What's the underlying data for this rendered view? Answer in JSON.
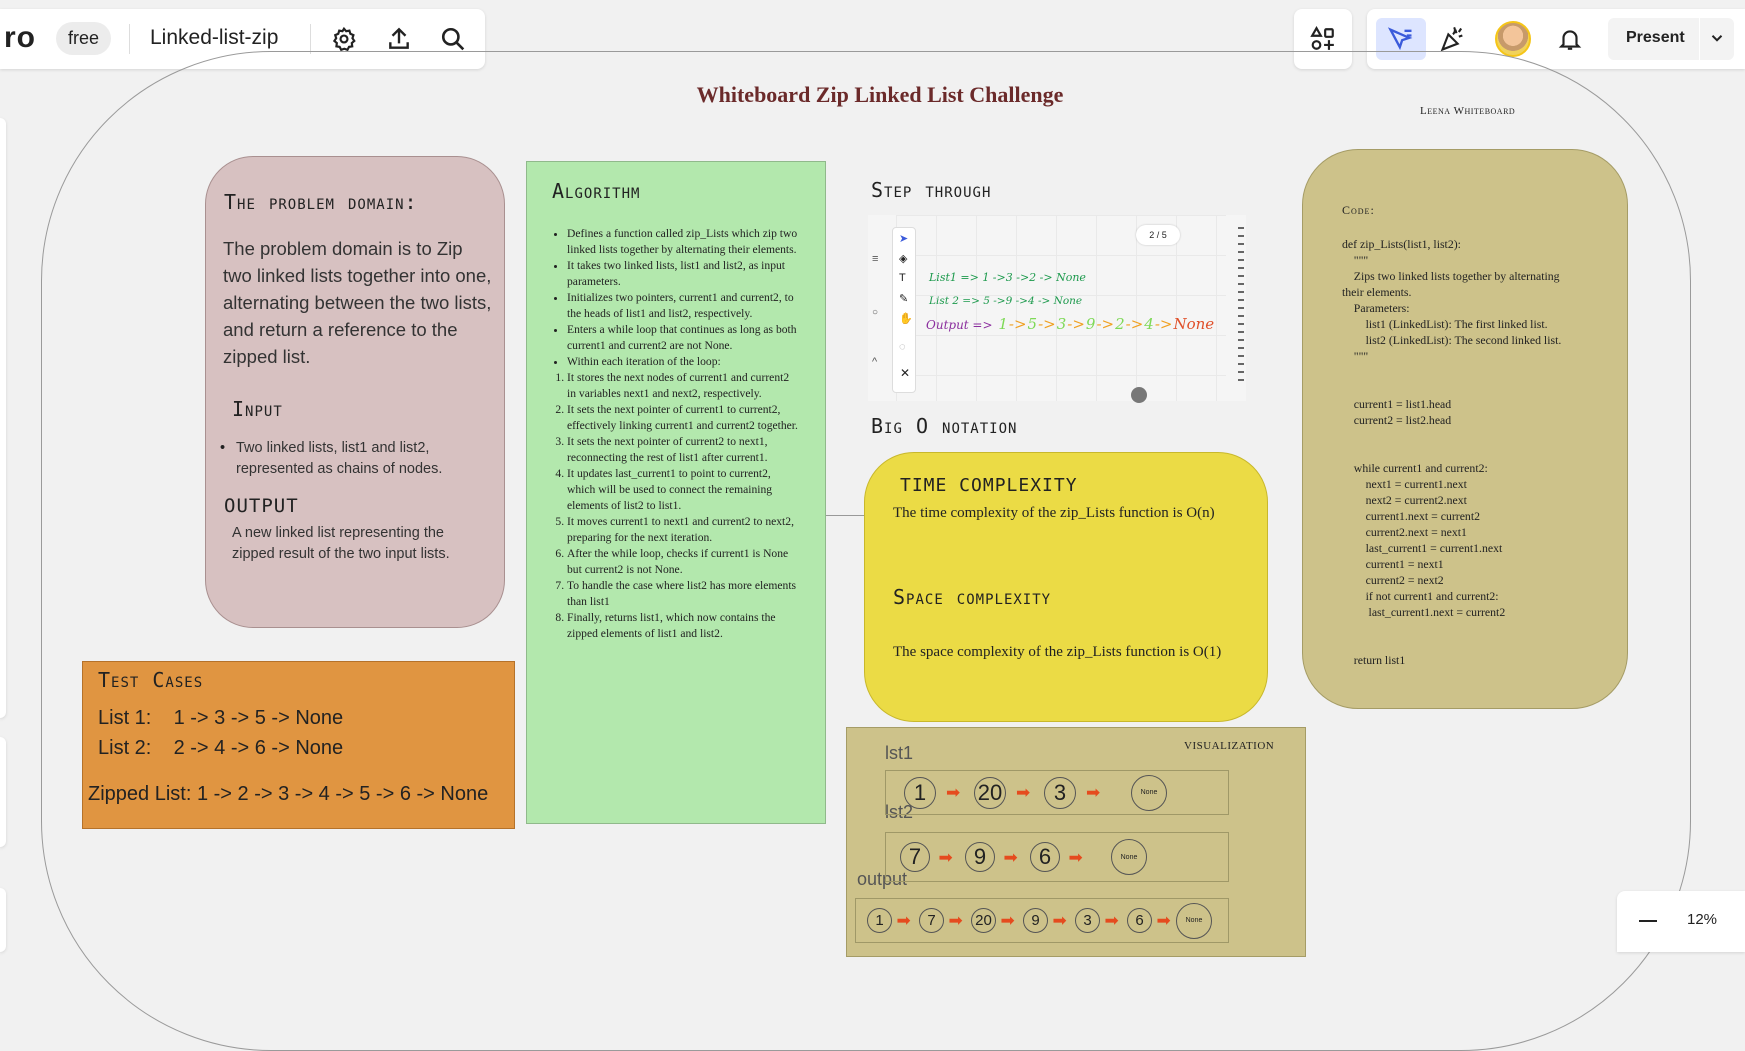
{
  "toolbar": {
    "logo": "ro",
    "plan_badge": "free",
    "board_name": "Linked-list-zip",
    "present_label": "Present",
    "zoom_level": "12%"
  },
  "icons": {
    "settings": "gear-icon",
    "export": "upload-icon",
    "search": "search-icon",
    "apps": "apps-icon",
    "cursor": "select-cursor-icon",
    "celebrate": "party-popper-icon",
    "bell": "bell-icon",
    "chevron": "chevron-down-icon",
    "zoom_out": "minus-icon"
  },
  "colors": {
    "accent_selected": "#dde5ff",
    "title_color": "#6b2a2a",
    "pink_card": "#d7c1c1",
    "green_card": "#b3e8ad",
    "orange_card": "#e09541",
    "yellow_card": "#ebdb45",
    "olive_card": "#cdc28a",
    "arrow": "#e54b1e"
  },
  "board": {
    "title": "Whiteboard Zip Linked List Challenge",
    "author": "Leena Whiteboard",
    "problem": {
      "heading": "The problem domain:",
      "text": "The problem domain is to Zip two linked lists together into one, alternating between the two lists, and return a reference to the zipped list.",
      "input_heading": "Input",
      "input_item": "Two linked lists, list1 and list2, represented as chains of nodes.",
      "output_heading": "OUTPUT",
      "output_text": "A new linked list representing the zipped result of the two input lists."
    },
    "test_cases": {
      "heading": "Test Cases",
      "list1": "List 1:    1 -> 3 -> 5 -> None",
      "list2": "List 2:    2 -> 4 -> 6 -> None",
      "zipped": "Zipped List: 1 -> 2 -> 3 -> 4 -> 5 -> 6 -> None"
    },
    "algorithm": {
      "heading": "Algorithm",
      "bullets": [
        "Defines a function called zip_Lists which zip two linked lists together by alternating their elements.",
        " It takes two linked lists, list1 and list2, as input parameters.",
        " Initializes two pointers, current1 and current2, to the heads of list1 and list2, respectively.",
        " Enters a while loop that continues as long as both current1 and current2 are not None.",
        " Within each iteration of the loop:"
      ],
      "steps": [
        "It stores the next nodes of current1 and current2 in variables next1 and next2, respectively.",
        "It sets the next pointer of current1 to current2, effectively linking current1 and current2 together.",
        "It sets the next pointer of current2 to next1, reconnecting the rest of list1 after current1.",
        "It updates last_current1 to point to current2, which will be used to connect the remaining elements of list2 to list1.",
        "It moves current1 to next1 and current2 to next2, preparing for the next iteration.",
        "After the while loop, checks if current1 is None but current2 is not None.",
        " To handle the case where list2 has more elements than list1",
        " Finally,  returns list1, which now contains the zipped elements of list1 and list2."
      ]
    },
    "step_through": {
      "heading": "Step through",
      "page_counter": "2 / 5",
      "line1": "List1 => 1 ->3 ->2 -> None",
      "line2": "List 2 => 5 ->9 ->4 -> None",
      "line3_label": "Output =>",
      "line3_values": [
        "1",
        "->",
        "5",
        "->",
        "3",
        "->",
        "9",
        "->",
        "2",
        "->",
        "4",
        "->",
        "None"
      ]
    },
    "big_o": {
      "heading": "Big O notation",
      "time_heading": "TIME COMPLEXITY",
      "time_text": "The time complexity of the zip_Lists function is O(n)",
      "space_heading": "Space complexity",
      "space_text": "The space complexity of the zip_Lists function is O(1)"
    },
    "code": {
      "label": "Code:",
      "lines": [
        "def zip_Lists(list1, list2):",
        "    \"\"\"",
        "    Zips two linked lists together by alternating",
        "their elements.",
        "    Parameters:",
        "        list1 (LinkedList): The first linked list.",
        "        list2 (LinkedList): The second linked list.",
        "    \"\"\"",
        "",
        "",
        "    current1 = list1.head",
        "    current2 = list2.head",
        "",
        "",
        "    while current1 and current2:",
        "        next1 = current1.next",
        "        next2 = current2.next",
        "        current1.next = current2",
        "        current2.next = next1",
        "        last_current1 = current1.next",
        "        current1 = next1",
        "        current2 = next2",
        "        if not current1 and current2:",
        "         last_current1.next = current2",
        "",
        "",
        "    return list1"
      ]
    },
    "visualization": {
      "label": "VISUALIZATION",
      "lst1_label": "lst1",
      "lst2_label": "lst2",
      "output_label": "output",
      "lst1": [
        "1",
        "20",
        "3"
      ],
      "lst2": [
        "7",
        "9",
        "6"
      ],
      "output": [
        "1",
        "7",
        "20",
        "9",
        "3",
        "6"
      ],
      "none_label": "None"
    }
  }
}
